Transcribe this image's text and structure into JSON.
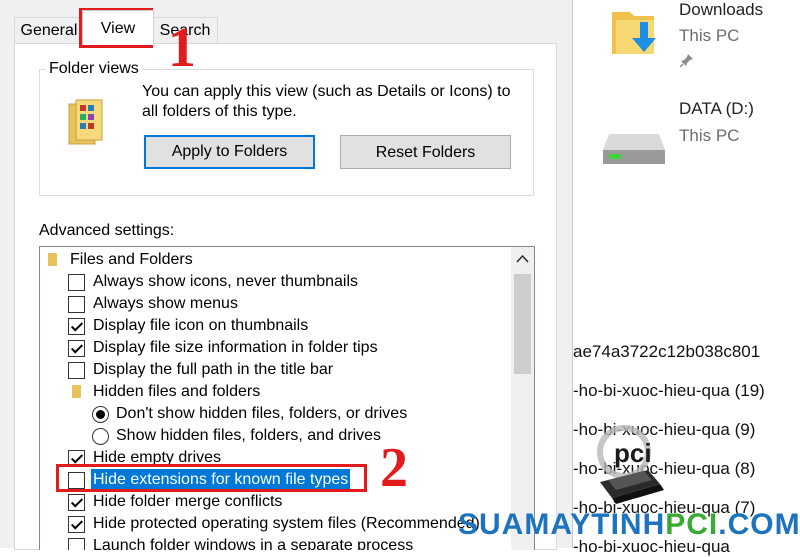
{
  "tabs": {
    "general": "General",
    "view": "View",
    "search": "Search"
  },
  "folder_views": {
    "label": "Folder views",
    "description_line1": "You can apply this view (such as Details or Icons) to",
    "description_line2": "all folders of this type.",
    "apply_button": "Apply to Folders",
    "reset_button": "Reset Folders"
  },
  "advanced": {
    "label": "Advanced settings:",
    "items": [
      {
        "type": "folder",
        "label": "Files and Folders"
      },
      {
        "type": "checkbox",
        "label": "Always show icons, never thumbnails",
        "checked": false
      },
      {
        "type": "checkbox",
        "label": "Always show menus",
        "checked": false
      },
      {
        "type": "checkbox",
        "label": "Display file icon on thumbnails",
        "checked": true
      },
      {
        "type": "checkbox",
        "label": "Display file size information in folder tips",
        "checked": true
      },
      {
        "type": "checkbox",
        "label": "Display the full path in the title bar",
        "checked": false
      },
      {
        "type": "folder",
        "label": "Hidden files and folders"
      },
      {
        "type": "radio",
        "label": "Don't show hidden files, folders, or drives",
        "checked": true
      },
      {
        "type": "radio",
        "label": "Show hidden files, folders, and drives",
        "checked": false
      },
      {
        "type": "checkbox",
        "label": "Hide empty drives",
        "checked": true
      },
      {
        "type": "checkbox",
        "label": "Hide extensions for known file types",
        "checked": false,
        "selected": true
      },
      {
        "type": "checkbox",
        "label": "Hide folder merge conflicts",
        "checked": true
      },
      {
        "type": "checkbox",
        "label": "Hide protected operating system files (Recommended)",
        "checked": true
      },
      {
        "type": "checkbox",
        "label": "Launch folder windows in a separate process",
        "checked": false
      }
    ]
  },
  "explorer": {
    "downloads": {
      "title": "Downloads",
      "sub": "This PC"
    },
    "drive": {
      "title": "DATA (D:)",
      "sub": "This PC"
    },
    "files": [
      "ae74a3722c12b038c801",
      "-ho-bi-xuoc-hieu-qua (19)",
      "-ho-bi-xuoc-hieu-qua (9)",
      "-ho-bi-xuoc-hieu-qua (8)",
      "-ho-bi-xuoc-hieu-qua (7)",
      "-ho-bi-xuoc-hieu-qua"
    ]
  },
  "annotations": {
    "step1": "1",
    "step2": "2"
  },
  "watermark": {
    "text": "SUAMAYTINHPCI.COM",
    "logo": "pci"
  },
  "colors": {
    "accent": "#0078d7",
    "annotation": "#e21c1c",
    "folder": "#e8c25a",
    "wm_blue": "#1e73be",
    "wm_green": "#3aaa35"
  }
}
